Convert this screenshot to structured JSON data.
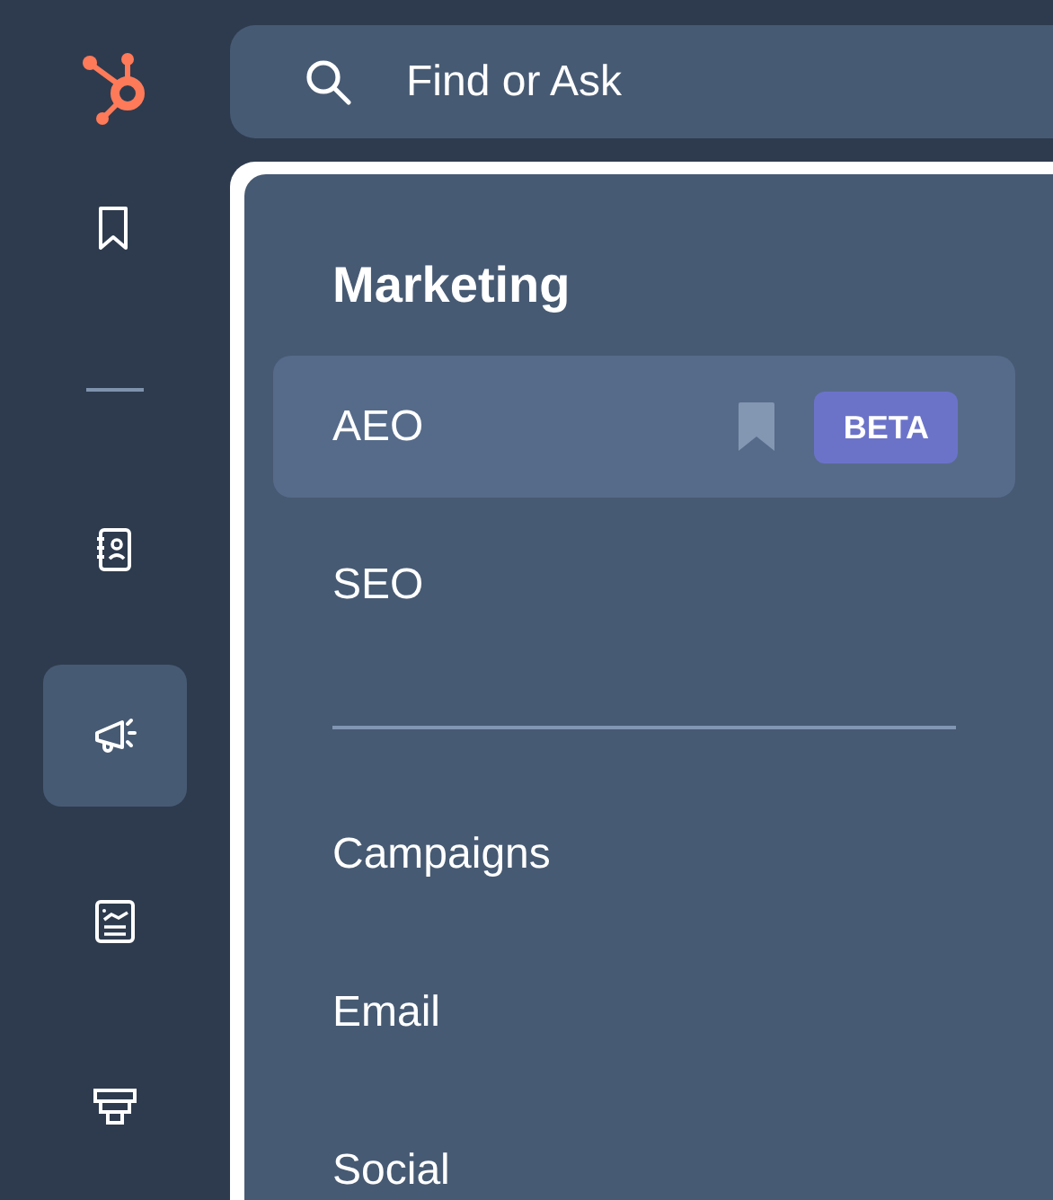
{
  "rail": [
    {
      "kind": "bookmarks",
      "selected": false
    },
    {
      "kind": "divider"
    },
    {
      "kind": "contacts",
      "selected": false
    },
    {
      "kind": "marketing",
      "selected": true
    },
    {
      "kind": "reports",
      "selected": false
    },
    {
      "kind": "funnel",
      "selected": false
    }
  ],
  "search": {
    "placeholder": "Find or Ask"
  },
  "menu": {
    "title": "Marketing",
    "items": [
      {
        "kind": "link",
        "label": "AEO",
        "selected": true,
        "show_bookmark": true,
        "badge": "BETA"
      },
      {
        "kind": "link",
        "label": "SEO",
        "selected": false,
        "show_bookmark": false
      },
      {
        "kind": "divider"
      },
      {
        "kind": "link",
        "label": "Campaigns",
        "selected": false,
        "show_bookmark": false
      },
      {
        "kind": "link",
        "label": "Email",
        "selected": false,
        "show_bookmark": false
      },
      {
        "kind": "link",
        "label": "Social",
        "selected": false,
        "show_bookmark": false
      }
    ]
  }
}
